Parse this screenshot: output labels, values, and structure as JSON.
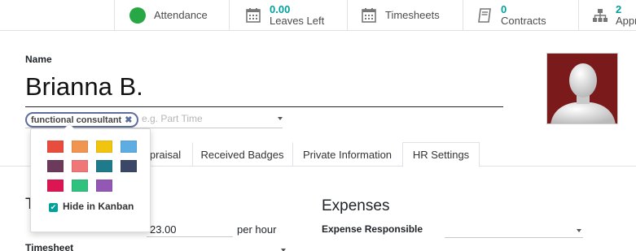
{
  "smart_buttons": [
    {
      "label": "Attendance",
      "icon": "green-dot-icon"
    },
    {
      "number": "0.00",
      "label": "Leaves Left",
      "icon": "calendar-icon"
    },
    {
      "label": "Timesheets",
      "icon": "calendar-icon"
    },
    {
      "number": "0",
      "label": "Contracts",
      "icon": "book-icon"
    },
    {
      "number": "2",
      "label": "Appr",
      "icon": "org-chart-icon"
    }
  ],
  "employee": {
    "name_label": "Name",
    "name": "Brianna B.",
    "tag": "functional consultant",
    "tag_remove": "✖",
    "tag_placeholder": "e.g. Part Time"
  },
  "tabs": [
    {
      "label": "praisal"
    },
    {
      "label": "Received Badges"
    },
    {
      "label": "Private Information"
    },
    {
      "label": "HR Settings",
      "active": true
    }
  ],
  "color_picker": {
    "colors": [
      "#e74c3c",
      "#f0944f",
      "#f1c40f",
      "#5dade2",
      "#6c3a5b",
      "#f07777",
      "#1f7a8c",
      "#3a4766",
      "#dc1652",
      "#2ec27e",
      "#9357b4"
    ],
    "hide_label": "Hide in Kanban",
    "hide_checked": true,
    "check_mark": "✔"
  },
  "left_section": {
    "title_initial": "T",
    "cost_value": "23.00",
    "cost_unit": "per hour",
    "timesheet_label": "Timesheet"
  },
  "right_section": {
    "title": "Expenses",
    "expense_label": "Expense Responsible"
  }
}
